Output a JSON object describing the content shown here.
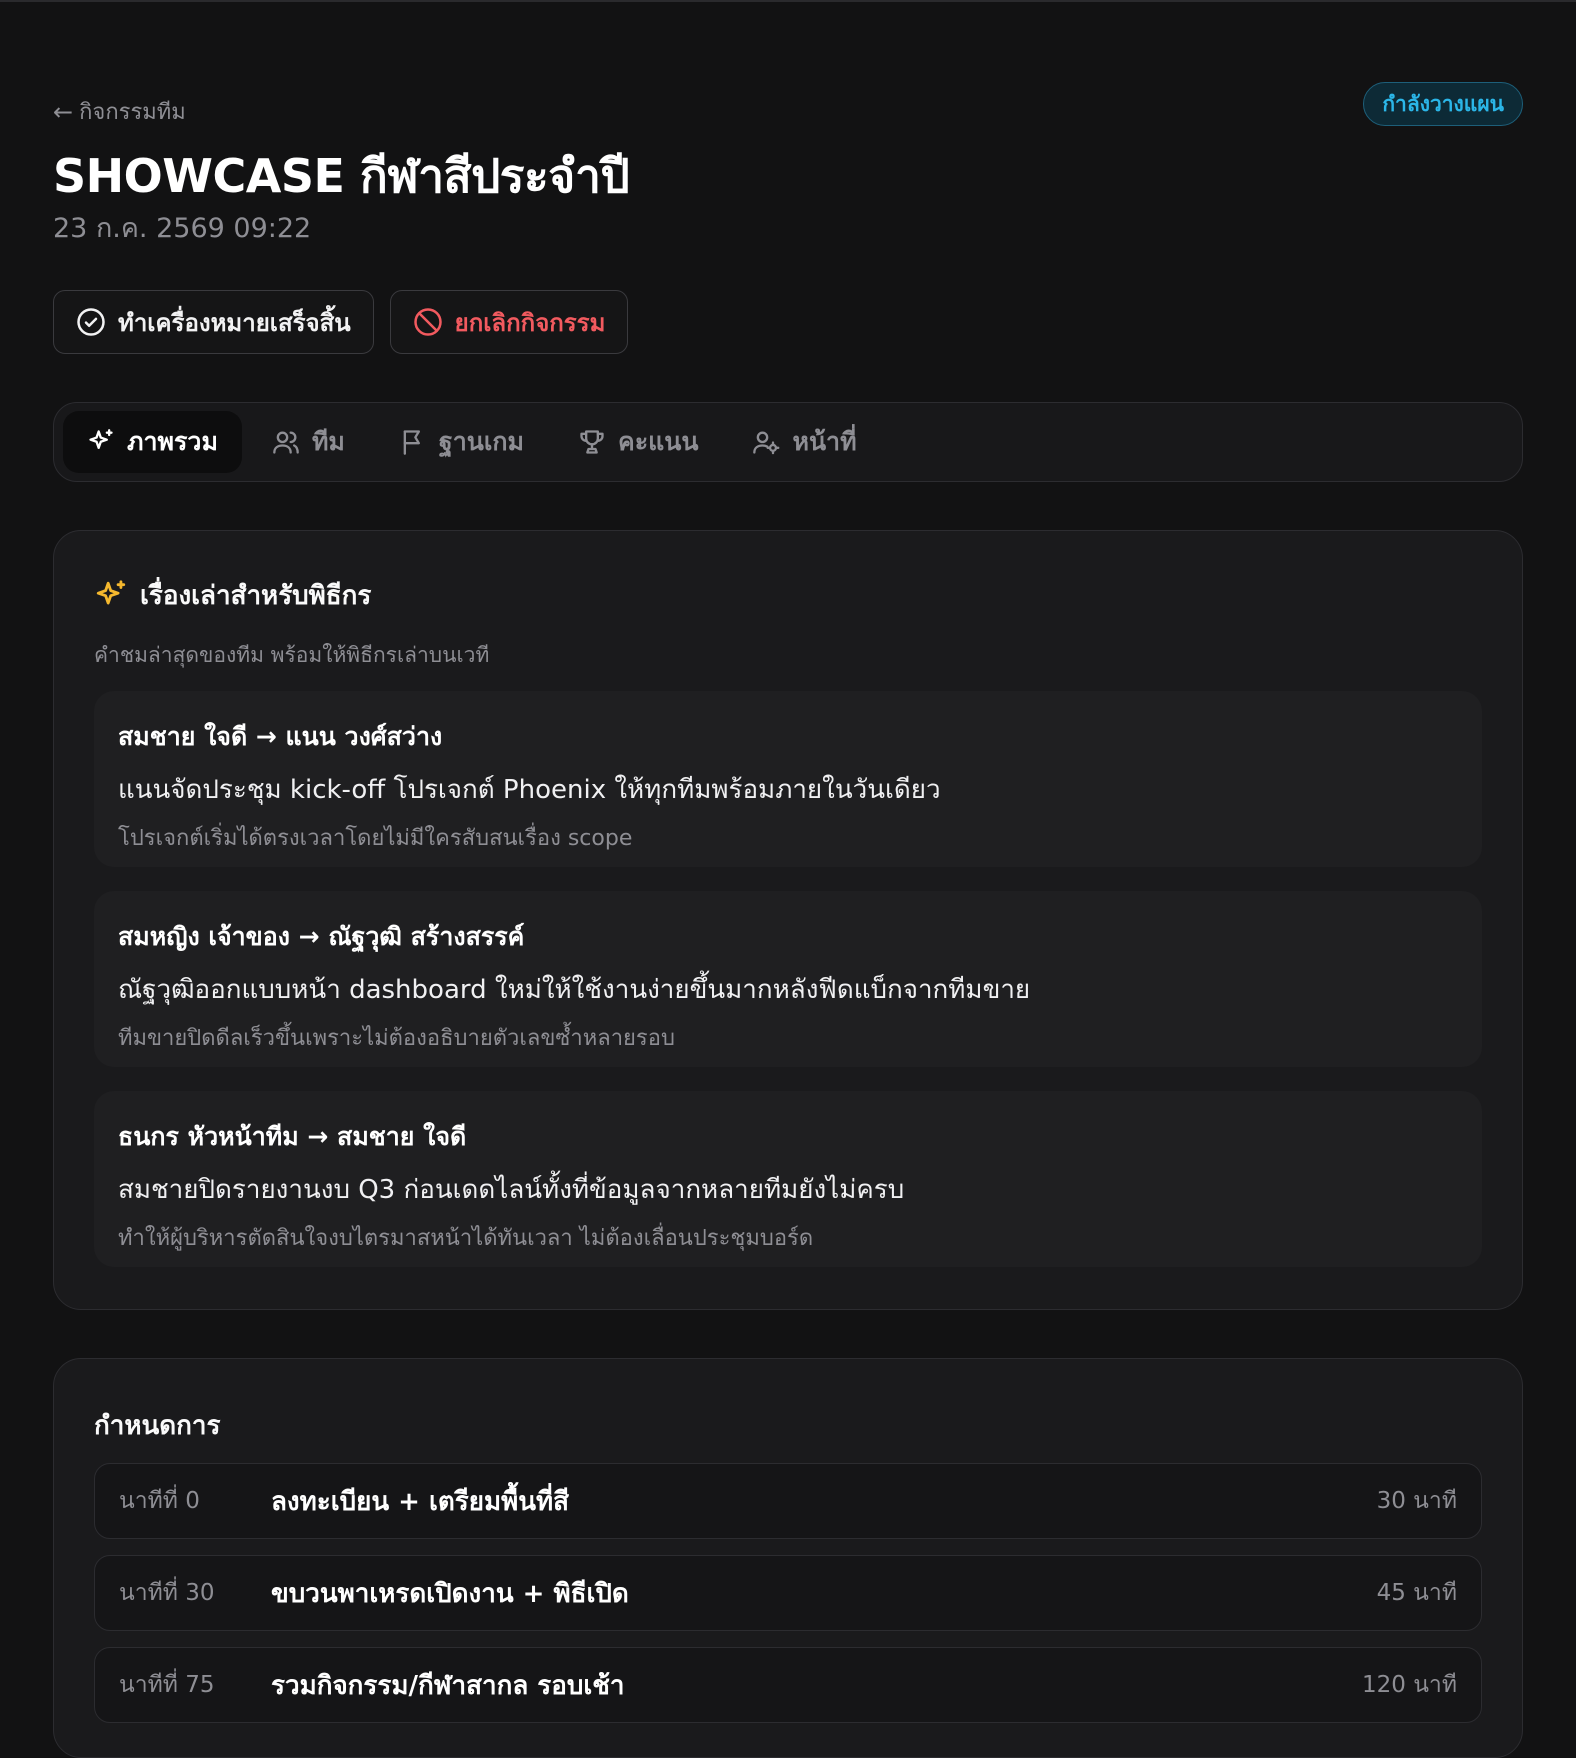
{
  "header": {
    "back_label": "กิจกรรมทีม",
    "back_arrow": "←",
    "status": "กำลังวางแผน",
    "title": "SHOWCASE กีฬาสีประจำปี",
    "datetime": "23 ก.ค. 2569 09:22"
  },
  "actions": {
    "complete_label": "ทำเครื่องหมายเสร็จสิ้น",
    "cancel_label": "ยกเลิกกิจกรรม"
  },
  "tabs": [
    {
      "label": "ภาพรวม",
      "icon": "sparkles-icon",
      "active": true
    },
    {
      "label": "ทีม",
      "icon": "users-icon",
      "active": false
    },
    {
      "label": "ฐานเกม",
      "icon": "flag-icon",
      "active": false
    },
    {
      "label": "คะแนน",
      "icon": "trophy-icon",
      "active": false
    },
    {
      "label": "หน้าที่",
      "icon": "user-cog-icon",
      "active": false
    }
  ],
  "mc_stories": {
    "title": "เรื่องเล่าสำหรับพิธีกร",
    "description": "คำชมล่าสุดของทีม พร้อมให้พิธีกรเล่าบนเวที",
    "items": [
      {
        "from_to": "สมชาย ใจดี → แนน วงศ์สว่าง",
        "what": "แนนจัดประชุม kick-off โปรเจกต์ Phoenix ให้ทุกทีมพร้อมภายในวันเดียว",
        "impact": "โปรเจกต์เริ่มได้ตรงเวลาโดยไม่มีใครสับสนเรื่อง scope"
      },
      {
        "from_to": "สมหญิง เจ้าของ → ณัฐวุฒิ สร้างสรรค์",
        "what": "ณัฐวุฒิออกแบบหน้า dashboard ใหม่ให้ใช้งานง่ายขึ้นมากหลังฟีดแบ็กจากทีมขาย",
        "impact": "ทีมขายปิดดีลเร็วขึ้นเพราะไม่ต้องอธิบายตัวเลขซ้ำหลายรอบ"
      },
      {
        "from_to": "ธนกร หัวหน้าทีม → สมชาย ใจดี",
        "what": "สมชายปิดรายงานงบ Q3 ก่อนเดดไลน์ทั้งที่ข้อมูลจากหลายทีมยังไม่ครบ",
        "impact": "ทำให้ผู้บริหารตัดสินใจงบไตรมาสหน้าได้ทันเวลา ไม่ต้องเลื่อนประชุมบอร์ด"
      }
    ]
  },
  "agenda": {
    "title": "กำหนดการ",
    "items": [
      {
        "minute": "นาทีที่ 0",
        "activity": "ลงทะเบียน + เตรียมพื้นที่สี",
        "duration": "30 นาที"
      },
      {
        "minute": "นาทีที่ 30",
        "activity": "ขบวนพาเหรดเปิดงาน + พิธีเปิด",
        "duration": "45 นาที"
      },
      {
        "minute": "นาทีที่ 75",
        "activity": "รวมกิจกรรม/กีฬาสากล รอบเช้า",
        "duration": "120 นาที"
      }
    ]
  },
  "colors": {
    "background": "#121213",
    "status_accent": "#2bb6e8",
    "danger": "#f25a5f",
    "highlight_icon": "#f5b82e"
  }
}
